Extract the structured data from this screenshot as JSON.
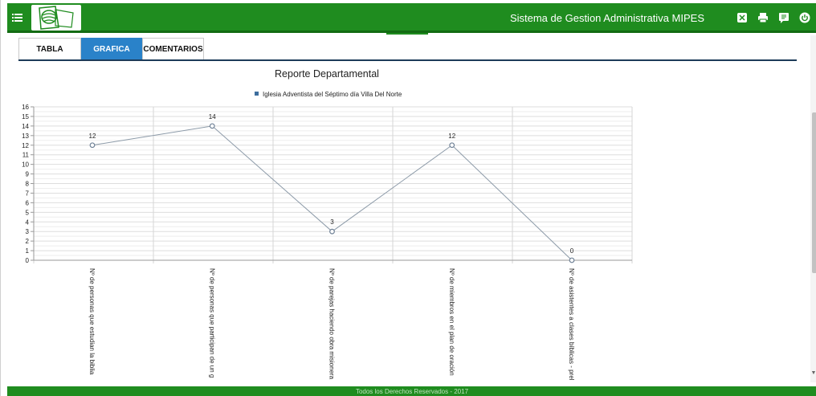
{
  "header": {
    "app_title": "Sistema de Gestion Administrativa MIPES",
    "icons": [
      "menu-icon",
      "logo",
      "fullscreen-icon",
      "print-icon",
      "comments-icon",
      "power-icon"
    ]
  },
  "tabs": [
    {
      "label": "TABLA",
      "active": false
    },
    {
      "label": "GRAFICA",
      "active": true
    },
    {
      "label": "COMENTARIOS",
      "active": false
    }
  ],
  "colors": {
    "brand_green": "#1f8c1f",
    "tab_active": "#2a82c9",
    "series": "#8c9aa8",
    "legend_marker": "#3d6e9e"
  },
  "chart_data": {
    "type": "line",
    "title": "Reporte Departamental",
    "categories": [
      "Nº de personas que estudian la biblia",
      "Nº de personas que participan de un g",
      "Nº de parejas haciendo obra misionera",
      "Nº de miembros en el plan de oración",
      "Nº de asistentes a clases bíblicas - prel"
    ],
    "series": [
      {
        "name": "Iglesia Adventista del Séptimo día Villa Del Norte",
        "values": [
          12,
          14,
          3,
          12,
          0
        ]
      }
    ],
    "ylim": [
      0,
      16
    ],
    "yticks": [
      0,
      1,
      2,
      3,
      4,
      5,
      6,
      7,
      8,
      9,
      10,
      11,
      12,
      13,
      14,
      15,
      16
    ],
    "legend_position": "top",
    "grid": true
  },
  "footer": {
    "text": "Todos los Derechos Reservados - 2017"
  }
}
